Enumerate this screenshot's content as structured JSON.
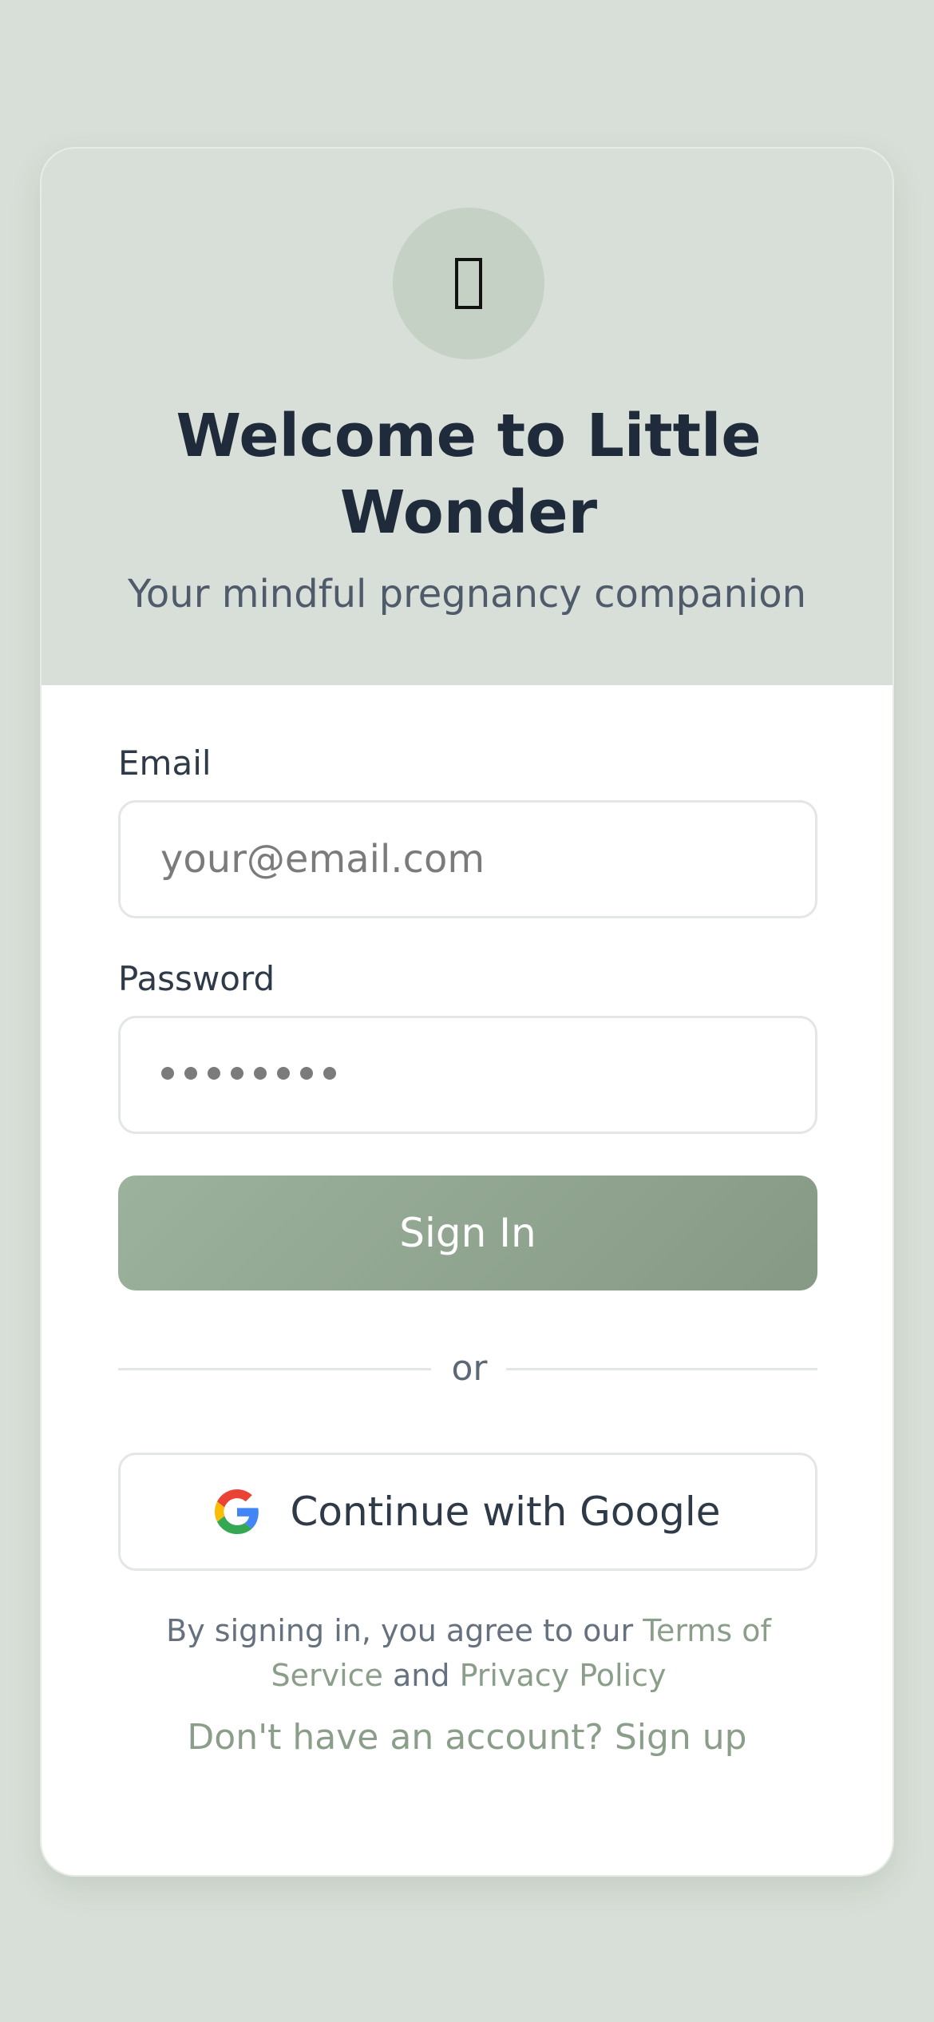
{
  "header": {
    "logo_icon": "sparkle-icon",
    "title": "Welcome to Little Wonder",
    "subtitle": "Your mindful pregnancy companion"
  },
  "form": {
    "email_label": "Email",
    "email_placeholder": "your@email.com",
    "email_value": "",
    "password_label": "Password",
    "password_value": "••••••••",
    "signin_label": "Sign In"
  },
  "divider": {
    "text": "or"
  },
  "google": {
    "icon": "google-icon",
    "label": "Continue with Google"
  },
  "legal": {
    "prefix": "By signing in, you agree to our ",
    "terms_link": "Terms of Service",
    "middle": " and ",
    "privacy_link": "Privacy Policy"
  },
  "signup": {
    "text": "Don't have an account? Sign up"
  },
  "colors": {
    "background": "#d8dfd8",
    "accent": "#9cb29c",
    "link": "#8a9e89",
    "title": "#1f2a3a"
  }
}
